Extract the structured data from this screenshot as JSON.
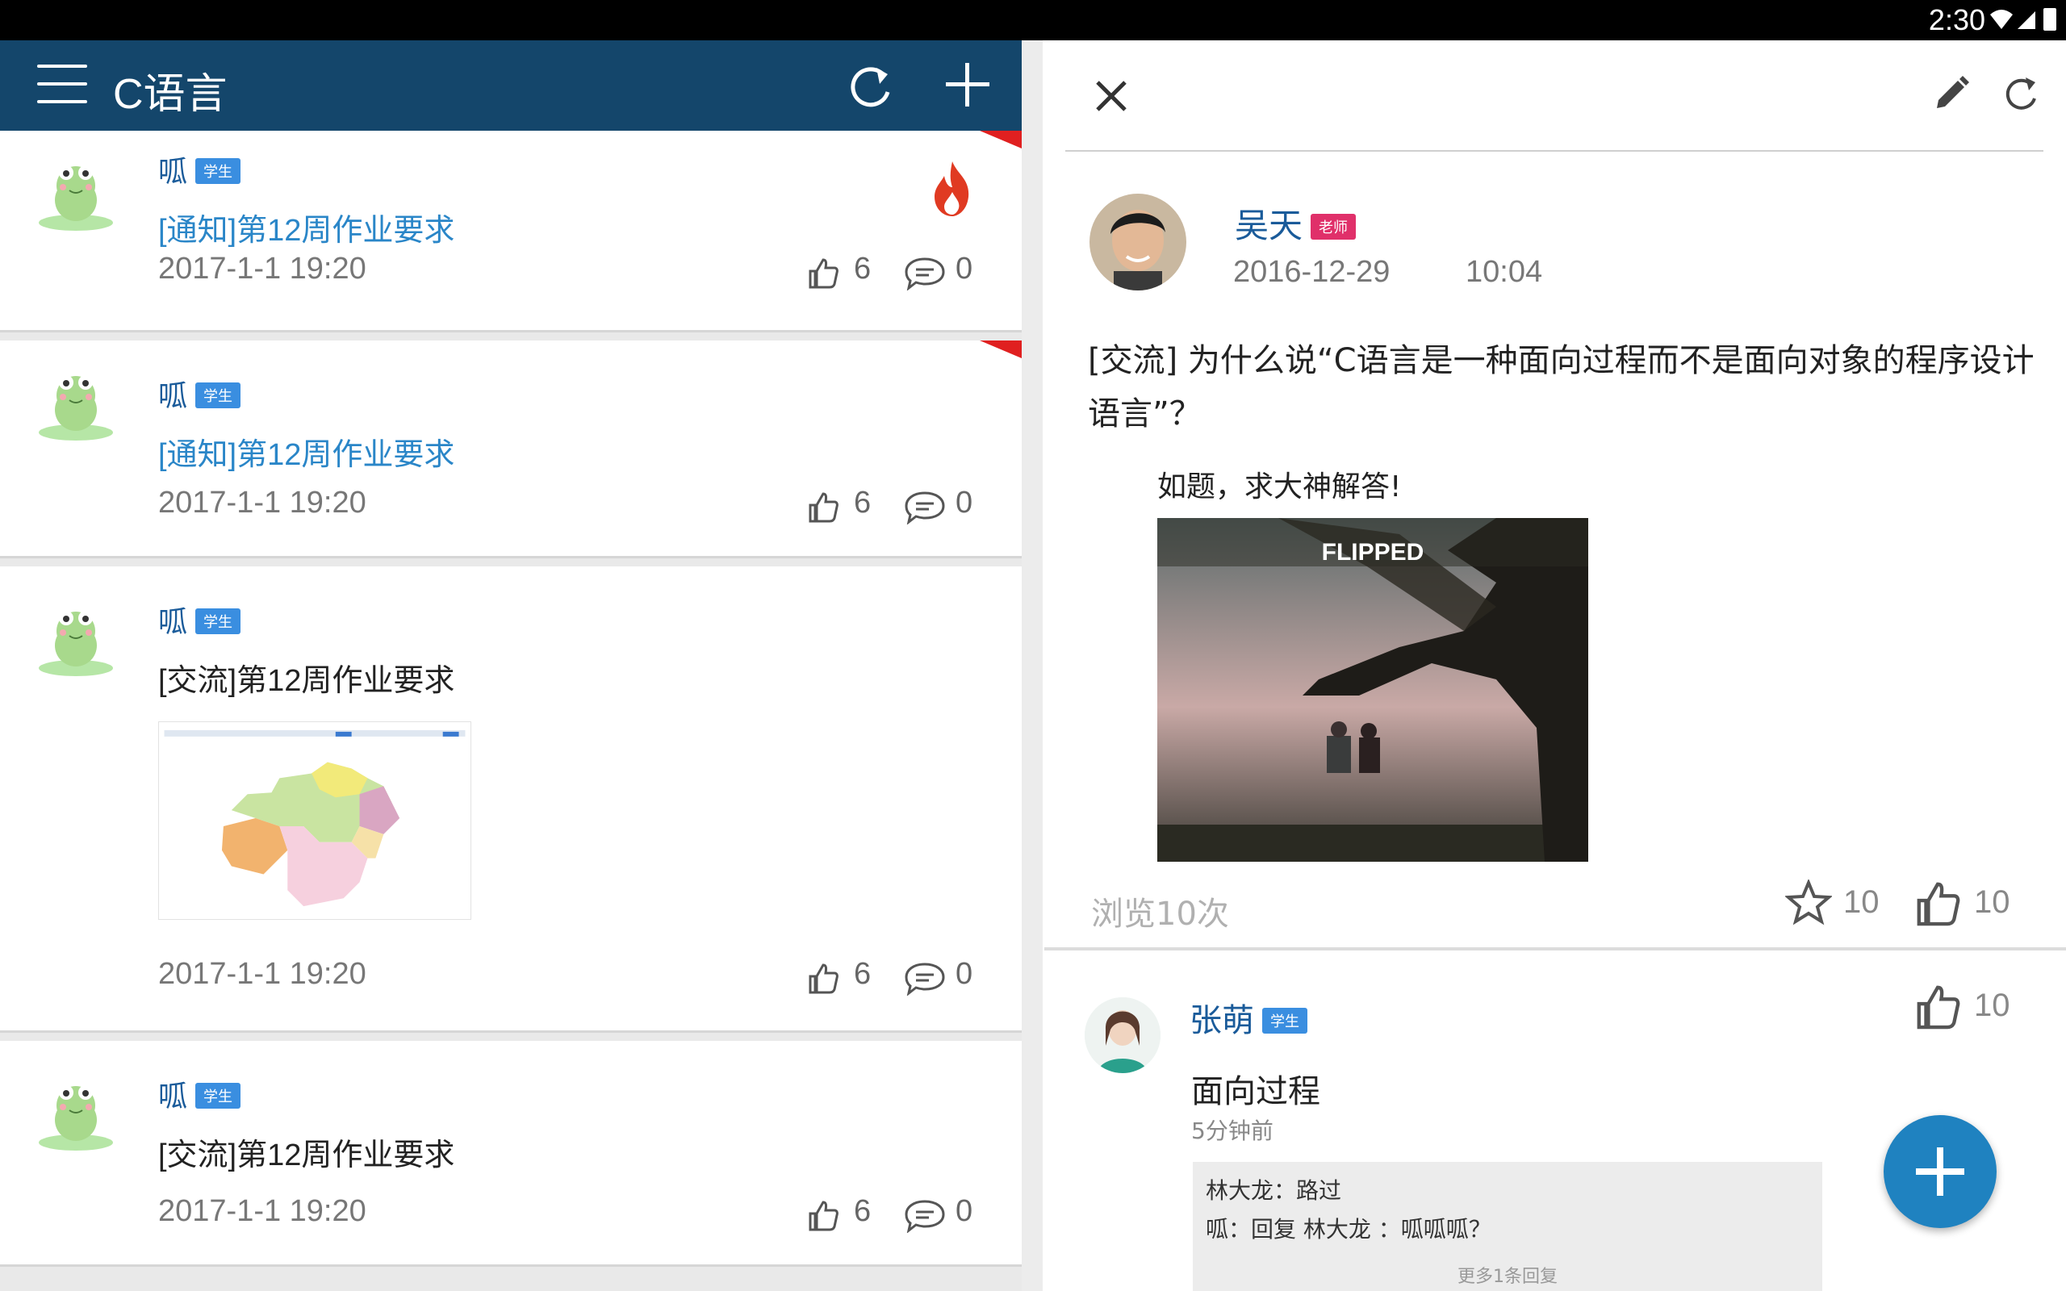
{
  "status_bar": {
    "time": "2:30"
  },
  "app_bar": {
    "title": "C语言"
  },
  "posts": [
    {
      "name": "呱",
      "role": "学生",
      "subject": "[通知]第12周作业要求",
      "date": "2017-1-1  19:20",
      "likes": "6",
      "comments": "0"
    },
    {
      "name": "呱",
      "role": "学生",
      "subject": "[通知]第12周作业要求",
      "date": "2017-1-1  19:20",
      "likes": "6",
      "comments": "0"
    },
    {
      "name": "呱",
      "role": "学生",
      "subject": "[交流]第12周作业要求",
      "date": "2017-1-1  19:20",
      "likes": "6",
      "comments": "0"
    },
    {
      "name": "呱",
      "role": "学生",
      "subject": "[交流]第12周作业要求",
      "date": "2017-1-1  19:20",
      "likes": "6",
      "comments": "0"
    }
  ],
  "detail": {
    "author": "吴天",
    "role": "老师",
    "date": "2016-12-29",
    "time": "10:04",
    "title": "[交流] 为什么说“C语言是一种面向过程而不是面向对象的程序设计语言”？",
    "body": "如题，求大神解答!",
    "image_text": "FLIPPED",
    "views": "浏览10次",
    "stars": "10",
    "likes": "10"
  },
  "reply": {
    "name": "张萌",
    "role": "学生",
    "text": "面向过程",
    "time": "5分钟前",
    "likes": "10",
    "sub_replies": [
      "林大龙：路过",
      "呱：回复 林大龙 ：呱呱呱？"
    ],
    "more": "更多1条回复"
  },
  "colors": {
    "app_bar": "#14466b",
    "accent": "#1f82c0",
    "link": "#2a86c8",
    "teacher_badge": "#e0306a",
    "student_badge": "#3a8ee0"
  }
}
